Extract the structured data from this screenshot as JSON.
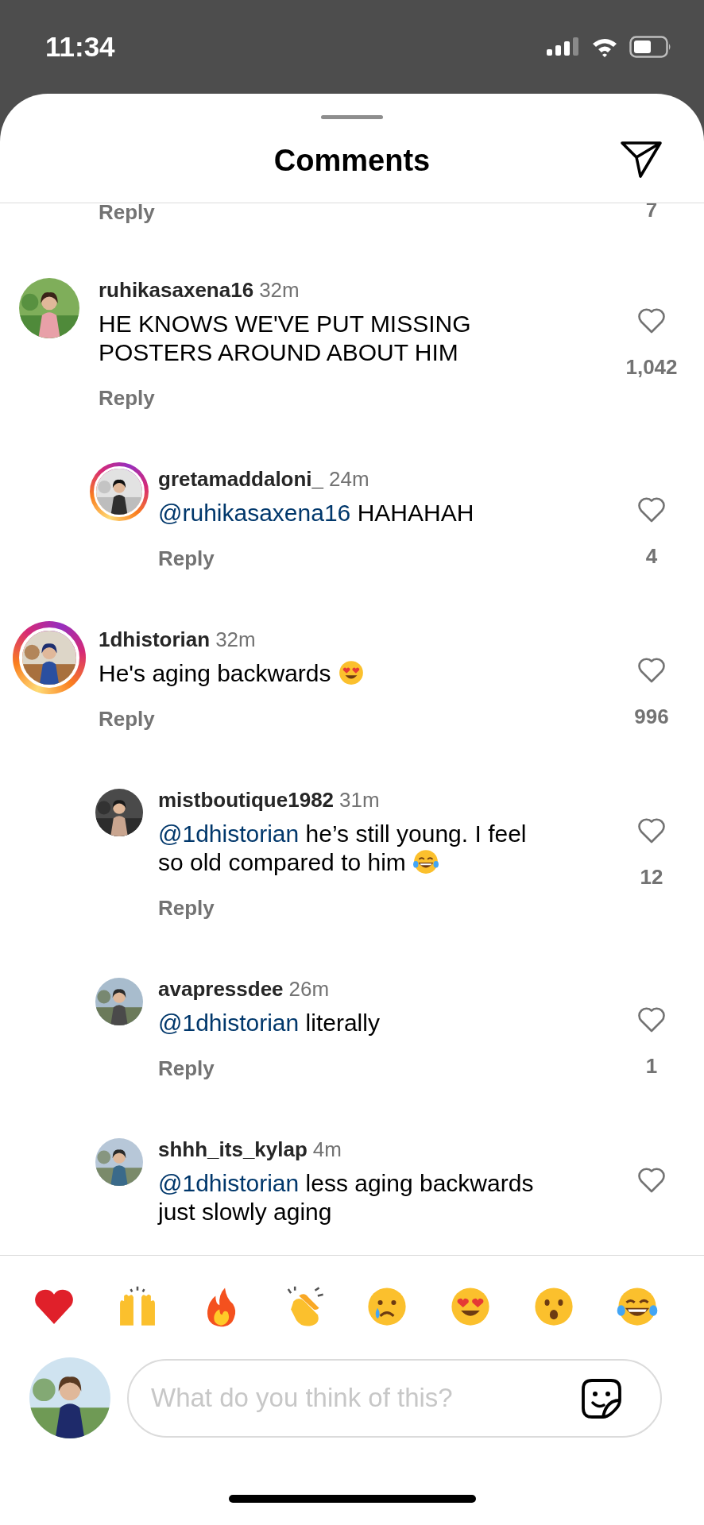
{
  "status_bar": {
    "time": "11:34"
  },
  "header": {
    "title": "Comments"
  },
  "cut_off_comment": {
    "reply": "Reply",
    "count": "7"
  },
  "comments": [
    {
      "kind": "top",
      "username": "ruhikasaxena16",
      "time": "32m",
      "story_ring": false,
      "text": "HE KNOWS WE'VE PUT MISSING\nPOSTERS AROUND ABOUT HIM",
      "reply": "Reply",
      "count": "1,042"
    },
    {
      "kind": "reply",
      "username": "gretamaddaloni_",
      "time": "24m",
      "story_ring": true,
      "mention": "@ruhikasaxena16",
      "text": "HAHAHAH",
      "reply": "Reply",
      "count": "4"
    },
    {
      "kind": "top",
      "username": "1dhistorian",
      "time": "32m",
      "story_ring": true,
      "text": "He's aging backwards",
      "emoji": {
        "kind": "heart_eyes"
      },
      "reply": "Reply",
      "count": "996"
    },
    {
      "kind": "reply",
      "username": "mistboutique1982",
      "time": "31m",
      "story_ring": false,
      "mention": "@1dhistorian",
      "text": "he’s still young. I feel\nso old compared to him",
      "emoji": {
        "kind": "laughing"
      },
      "reply": "Reply",
      "count": "12"
    },
    {
      "kind": "reply",
      "username": "avapressdee",
      "time": "26m",
      "story_ring": false,
      "mention": "@1dhistorian",
      "text": "literally",
      "reply": "Reply",
      "count": "1"
    },
    {
      "kind": "reply",
      "username": "shhh_its_kylap",
      "time": "4m",
      "story_ring": false,
      "mention": "@1dhistorian",
      "text": "less aging backwards\njust slowly aging"
    }
  ],
  "reactions": [
    {
      "kind": "heart"
    },
    {
      "kind": "raised_hands"
    },
    {
      "kind": "fire"
    },
    {
      "kind": "clap"
    },
    {
      "kind": "crying"
    },
    {
      "kind": "heart_eyes"
    },
    {
      "kind": "surprised"
    },
    {
      "kind": "laughing"
    }
  ],
  "composer": {
    "placeholder": "What do you think of this?"
  }
}
